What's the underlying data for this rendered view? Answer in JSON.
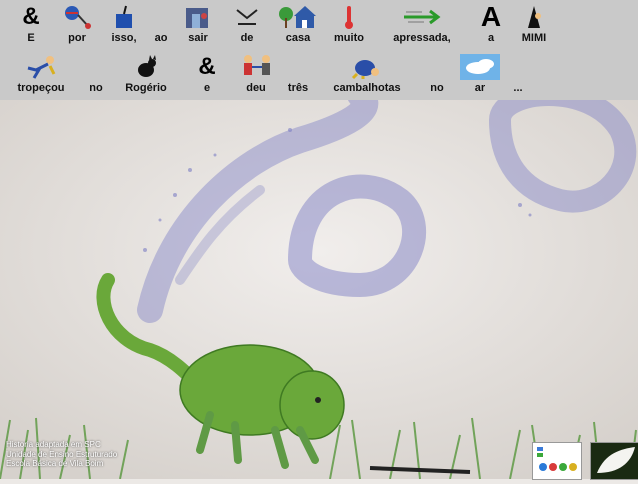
{
  "sentence_row1": {
    "w0": "E",
    "w1": "por",
    "w2": "isso,",
    "w3": "ao",
    "w4": "sair",
    "w5": "de",
    "w6": "casa",
    "w7": "muito",
    "w8": "apressada,",
    "w9": "a",
    "w10": "MIMI",
    "ampersand": "&",
    "letter_a": "A"
  },
  "sentence_row2": {
    "w0": "tropeçou",
    "w1": "no",
    "w2": "Rogério",
    "w3": "e",
    "w4": "deu",
    "w5": "três",
    "w6": "cambalhotas",
    "w7": "no",
    "w8": "ar",
    "w9": "...",
    "ampersand": "&"
  },
  "credits": {
    "line1": "Historia adaptada em SPC",
    "line2": "Unidade de Ensino Estruturado",
    "line3": "Escola Básica de Vila Boim"
  },
  "colors": {
    "symbol_band": "#c9c9c9",
    "cat_green": "#6aa83a",
    "smoke_purple": "#7d7fc4",
    "wall": "#ece9e6"
  }
}
